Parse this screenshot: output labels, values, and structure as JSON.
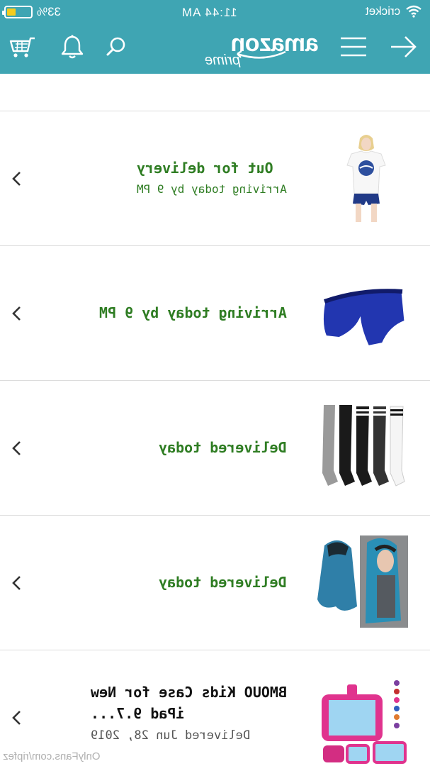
{
  "status_bar": {
    "battery_text": "33%",
    "time": "11:44 AM",
    "carrier": "cricket"
  },
  "header": {
    "logo_text": "amazon",
    "logo_sub": "prime",
    "icons": [
      "cart-icon",
      "bell-icon",
      "search-icon",
      "menu-icon",
      "arrow-back-icon"
    ]
  },
  "orders": [
    {
      "status": "Out for delivery",
      "detail": "Arriving today by 9 PM",
      "thumb": "nasa-tshirt-image"
    },
    {
      "status": "Arriving today by 9 PM",
      "thumb": "blue-shorts-image"
    },
    {
      "status": "Delivered today",
      "thumb": "thigh-high-socks-image"
    },
    {
      "status": "Delivered today",
      "thumb": "blue-wig-image"
    },
    {
      "title_line1": "BMOUO Kids Case for New",
      "title_line2": "iPad 9.7...",
      "detail": "Delivered Jun 28, 2019",
      "thumb": "pink-ipad-case-image"
    }
  ],
  "watermark": "OnlyFans.com/ripfez",
  "colors": {
    "header_bg": "#3fa5b3",
    "status_green": "#2f7d23",
    "divider": "#dcdcdc",
    "battery_fill": "#f4cc1e"
  }
}
